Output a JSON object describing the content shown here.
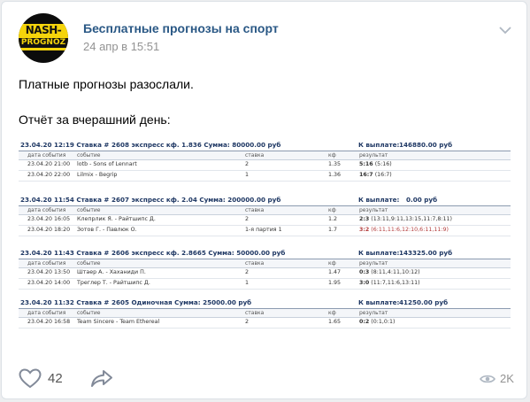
{
  "post": {
    "author": "Бесплатные прогнозы на спорт",
    "date": "24 апр в 15:51",
    "avatar_line1": "NASH-",
    "avatar_line2": "PROGNOZ",
    "text_line1": "Платные прогнозы разослали.",
    "text_line2": "Отчёт за вчерашний день:"
  },
  "report": {
    "columns": [
      "дата события",
      "событие",
      "ставка",
      "кф",
      "результат"
    ],
    "blocks": [
      {
        "head": "23.04.20 12:19  Ставка # 2608   экспресс кф. 1.836  Сумма: 80000.00 руб",
        "payout_label": "К выплате:",
        "payout": "146880.00 руб",
        "rows": [
          {
            "date": "23.04.20 21:00",
            "event": "lotb - Sons of Lennart",
            "stake": "2",
            "odds": "1.35",
            "score": "5:16",
            "detail": "(5:16)"
          },
          {
            "date": "23.04.20 22:00",
            "event": "Lilmix - Begrip",
            "stake": "1",
            "odds": "1.36",
            "score": "16:7",
            "detail": "(16:7)"
          }
        ]
      },
      {
        "head": "23.04.20 11:54  Ставка # 2607   экспресс кф. 2.04  Сумма: 200000.00 руб",
        "payout_label": "К выплате:",
        "payout": "0.00 руб",
        "rows": [
          {
            "date": "23.04.20 16:05",
            "event": "Клепрлик Я. - Райтшипс Д.",
            "stake": "2",
            "odds": "1.2",
            "score": "2:3",
            "detail": "(13:11,9:11,13:15,11:7,8:11)"
          },
          {
            "date": "23.04.20 18:20",
            "event": "Зотов Г. - Павлюк О.",
            "stake": "1-я партия 1",
            "odds": "1.7",
            "score": "3:2",
            "detail": "(6:11,11:6,12:10,6:11,11:9)",
            "loss": true
          }
        ]
      },
      {
        "head": "23.04.20 11:43  Ставка # 2606   экспресс кф. 2.8665  Сумма: 50000.00 руб",
        "payout_label": "К выплате:",
        "payout": "143325.00 руб",
        "rows": [
          {
            "date": "23.04.20 13:50",
            "event": "Штаер А. - Хаханиди П.",
            "stake": "2",
            "odds": "1.47",
            "score": "0:3",
            "detail": "(8:11,4:11,10:12)"
          },
          {
            "date": "23.04.20 14:00",
            "event": "Треглер Т. - Райтшипс Д.",
            "stake": "1",
            "odds": "1.95",
            "score": "3:0",
            "detail": "(11:7,11:6,13:11)"
          }
        ]
      },
      {
        "head": "23.04.20 11:32  Ставка # 2605   Одиночная  Сумма: 25000.00 руб",
        "payout_label": "К выплате:",
        "payout": "41250.00 руб",
        "rows": [
          {
            "date": "23.04.20 16:58",
            "event": "Team Sincere - Team Ethereal",
            "stake": "2",
            "odds": "1.65",
            "score": "0:2",
            "detail": "(0:1,0:1)"
          }
        ]
      }
    ]
  },
  "footer": {
    "likes": "42",
    "views": "2K"
  },
  "colors": {
    "link": "#2a5885",
    "muted": "#939393",
    "accent": "#f5d40b"
  }
}
